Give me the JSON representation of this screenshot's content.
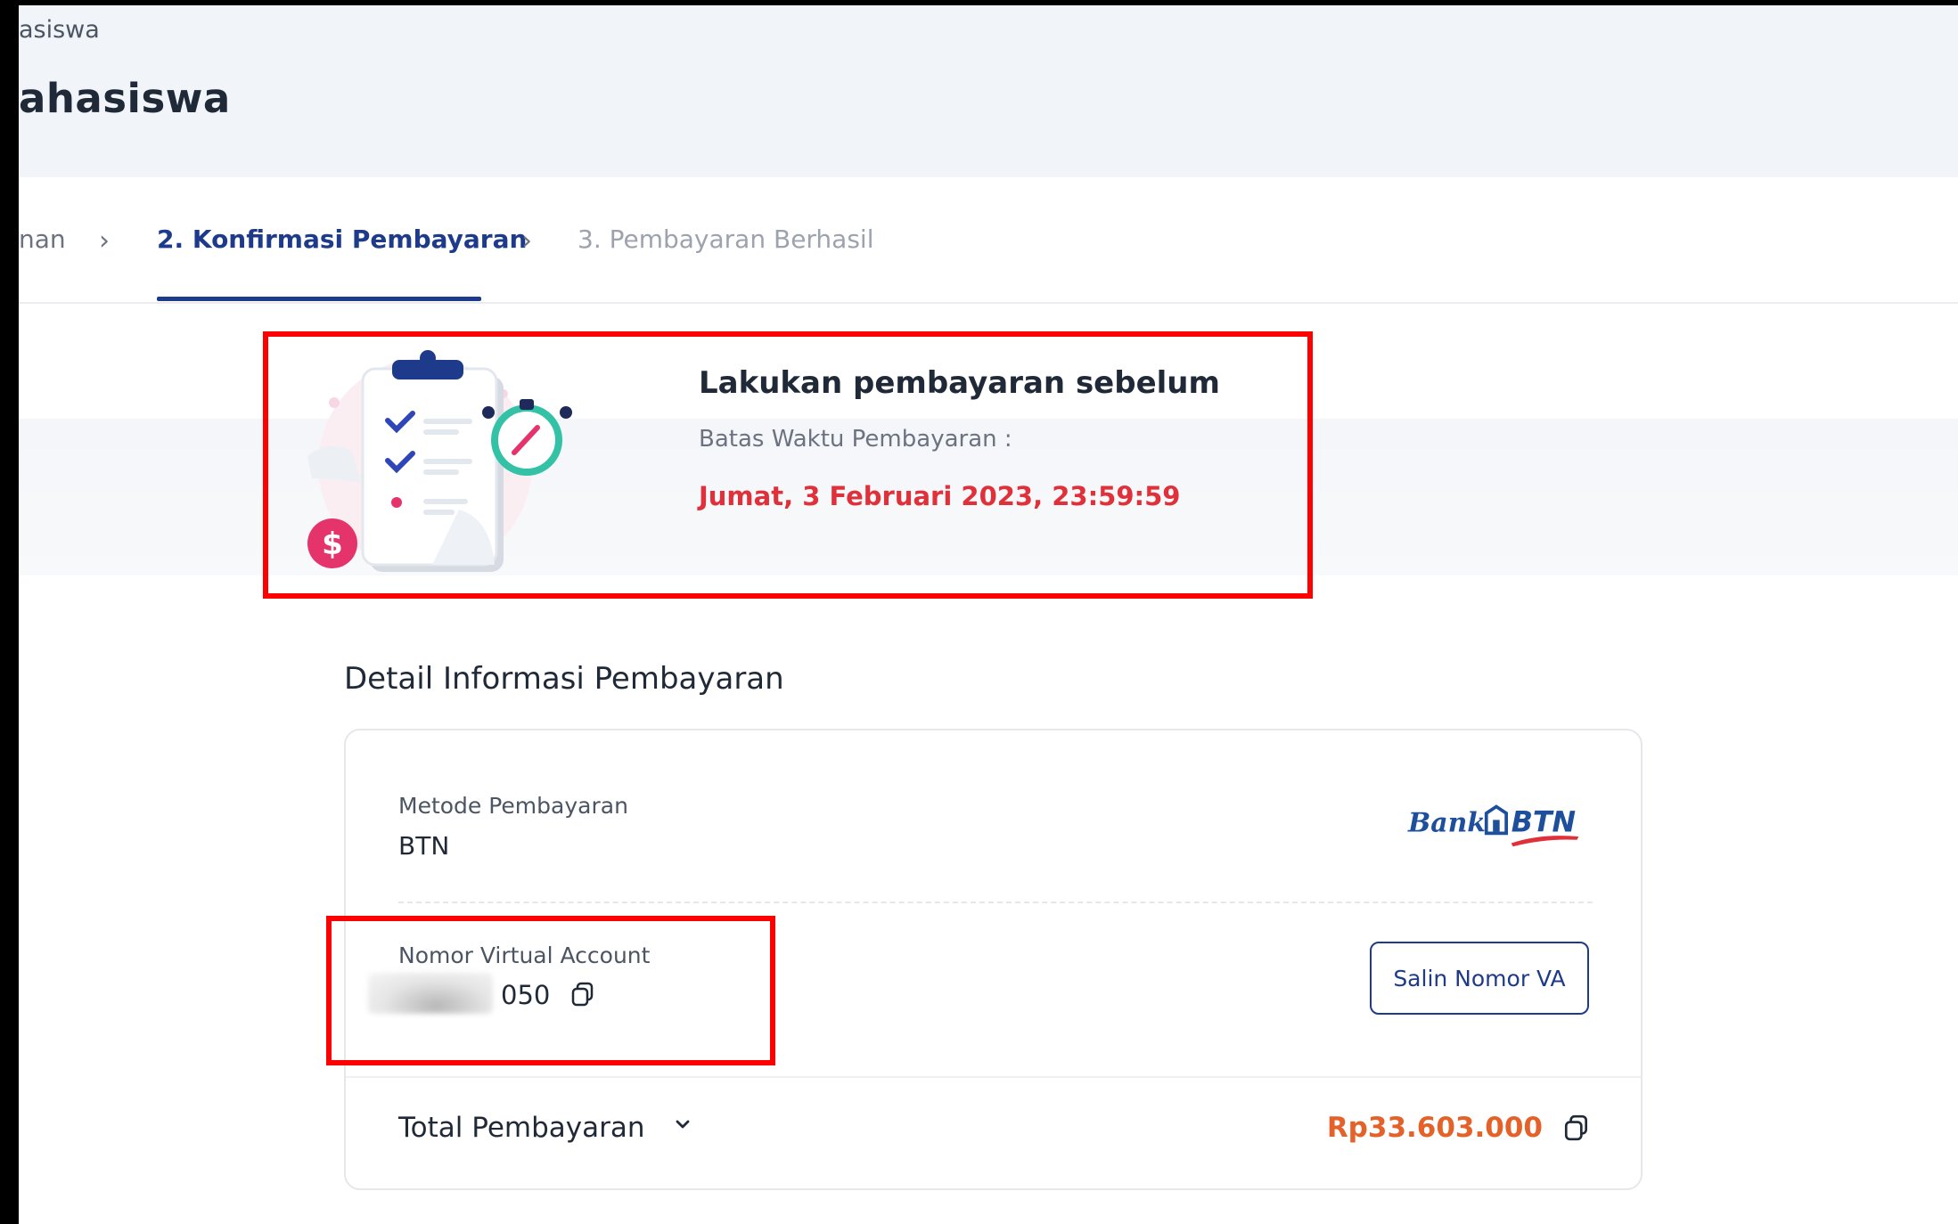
{
  "header": {
    "breadcrumb": "asiswa",
    "title": "ahasiswa"
  },
  "steps": [
    {
      "label": "nan",
      "state": "done"
    },
    {
      "label": "2. Konfirmasi Pembayaran",
      "state": "active"
    },
    {
      "label": "3. Pembayaran Berhasil",
      "state": "pending"
    }
  ],
  "deadline": {
    "title": "Lakukan pembayaran sebelum",
    "label": "Batas Waktu Pembayaran :",
    "value": "Jumat, 3 Februari 2023, 23:59:59"
  },
  "details": {
    "section_title": "Detail Informasi Pembayaran",
    "method_label": "Metode Pembayaran",
    "method_value": "BTN",
    "bank_logo": {
      "prefix": "Bank",
      "name": "BTN"
    },
    "va_label": "Nomor Virtual Account",
    "va_value": "050",
    "copy_va_button": "Salin Nomor VA",
    "total_label": "Total Pembayaran",
    "total_value": "Rp33.603.000"
  },
  "colors": {
    "primary": "#1e3a8a",
    "deadline_red": "#e0313b",
    "total_orange": "#e4622a",
    "highlight_red": "#ff0000"
  },
  "icons": [
    "chevron-right-icon",
    "clipboard-stopwatch-illustration",
    "copy-icon",
    "chevron-down-icon",
    "bank-btn-logo"
  ]
}
